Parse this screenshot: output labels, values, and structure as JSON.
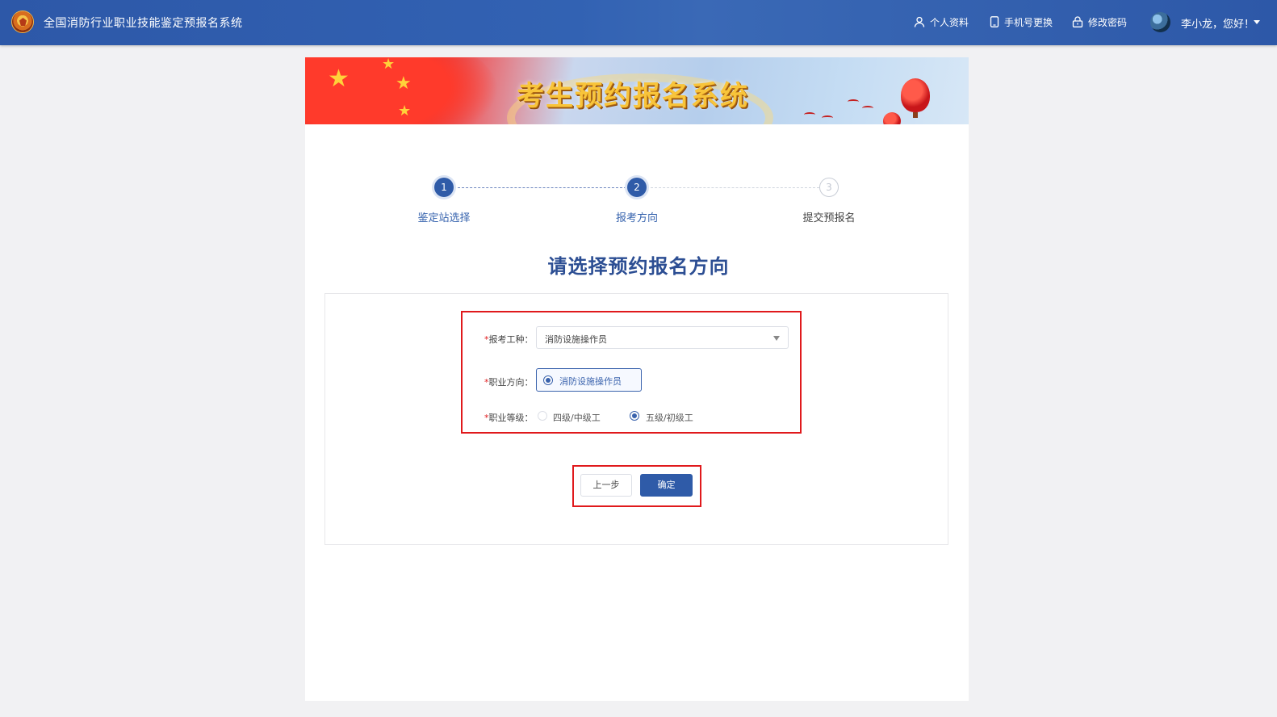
{
  "header": {
    "system_title": "全国消防行业职业技能鉴定预报名系统",
    "nav": {
      "profile": "个人资料",
      "phone_change": "手机号更换",
      "change_password": "修改密码"
    },
    "user_greeting": "李小龙，您好！"
  },
  "banner": {
    "title": "考生预约报名系统"
  },
  "steps": [
    {
      "number": "1",
      "label": "鉴定站选择",
      "state": "done"
    },
    {
      "number": "2",
      "label": "报考方向",
      "state": "current"
    },
    {
      "number": "3",
      "label": "提交预报名",
      "state": "todo"
    }
  ],
  "page_heading": "请选择预约报名方向",
  "form": {
    "job_type": {
      "required_mark": "*",
      "label": "报考工种：",
      "value": "消防设施操作员"
    },
    "career_direction": {
      "required_mark": "*",
      "label": "职业方向：",
      "option": "消防设施操作员",
      "selected": true
    },
    "career_level": {
      "required_mark": "*",
      "label": "职业等级：",
      "options": [
        {
          "label": "四级/中级工",
          "selected": false
        },
        {
          "label": "五级/初级工",
          "selected": true
        }
      ]
    }
  },
  "buttons": {
    "prev": "上一步",
    "confirm": "确定"
  },
  "colors": {
    "header_bg": "#2d58a8",
    "accent": "#2f5ba8",
    "highlight_border": "#e0191c",
    "page_bg": "#f1f1f3"
  }
}
